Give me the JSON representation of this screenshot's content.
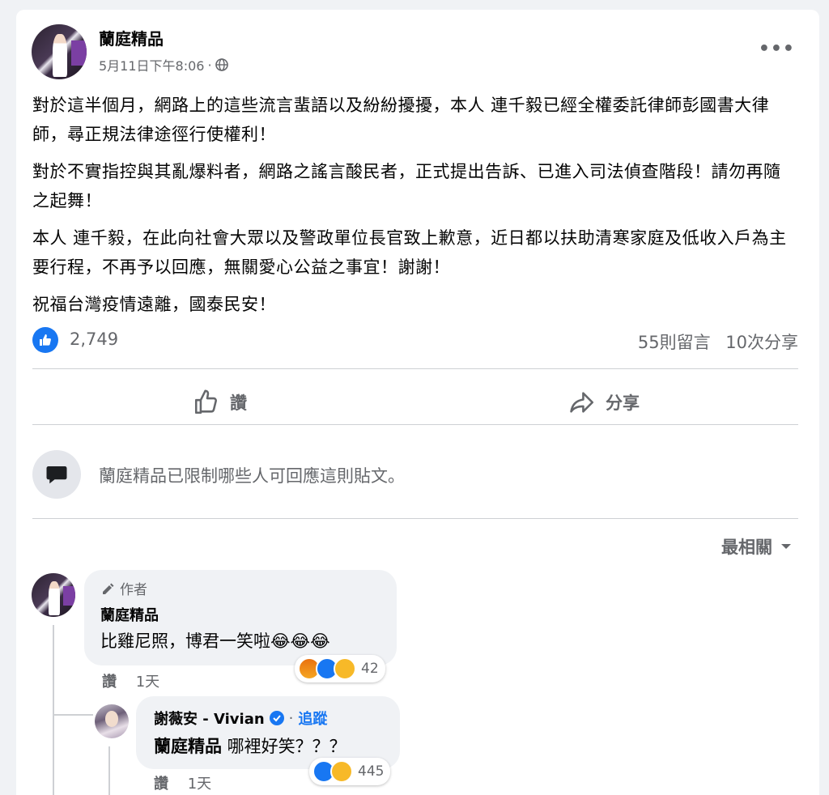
{
  "post": {
    "page_name": "蘭庭精品",
    "timestamp": "5月11日下午8:06",
    "separator": "·",
    "more": "•••",
    "paragraphs": [
      "對於這半個月，網路上的這些流言蜚語以及紛紛擾擾，本人 連千毅已經全權委託律師彭國書大律師，尋正規法律途徑行使權利！",
      "對於不實指控與其亂爆料者，網路之謠言酸民者，正式提出告訴、已進入司法偵查階段！請勿再隨之起舞！",
      "本人 連千毅，在此向社會大眾以及警政單位長官致上歉意，近日都以扶助清寒家庭及低收入戶為主要行程，不再予以回應，無關愛心公益之事宜！謝謝！",
      "祝福台灣疫情遠離，國泰民安！"
    ]
  },
  "stats": {
    "likes": "2,749",
    "comments": "55則留言",
    "shares": "10次分享"
  },
  "actions": {
    "like_label": "讚",
    "share_label": "分享"
  },
  "restriction_notice": "蘭庭精品已限制哪些人可回應這則貼文。",
  "sort_label": "最相關",
  "comments": [
    {
      "author_tag": "作者",
      "name": "蘭庭精品",
      "text": "比雞尼照，博君一笑啦😂😂😂",
      "reaction_count": "42",
      "like_label": "讚",
      "time": "1天"
    },
    {
      "name": "謝薇安 - Vivian",
      "follow_label": "追蹤",
      "separator": "·",
      "mention": "蘭庭精品",
      "text": " 哪裡好笑？？？",
      "reaction_count": "445",
      "like_label": "讚",
      "time": "1天"
    }
  ],
  "colors": {
    "accent": "#1877f2",
    "secondary_text": "#65676b",
    "background": "#f0f2f5"
  }
}
